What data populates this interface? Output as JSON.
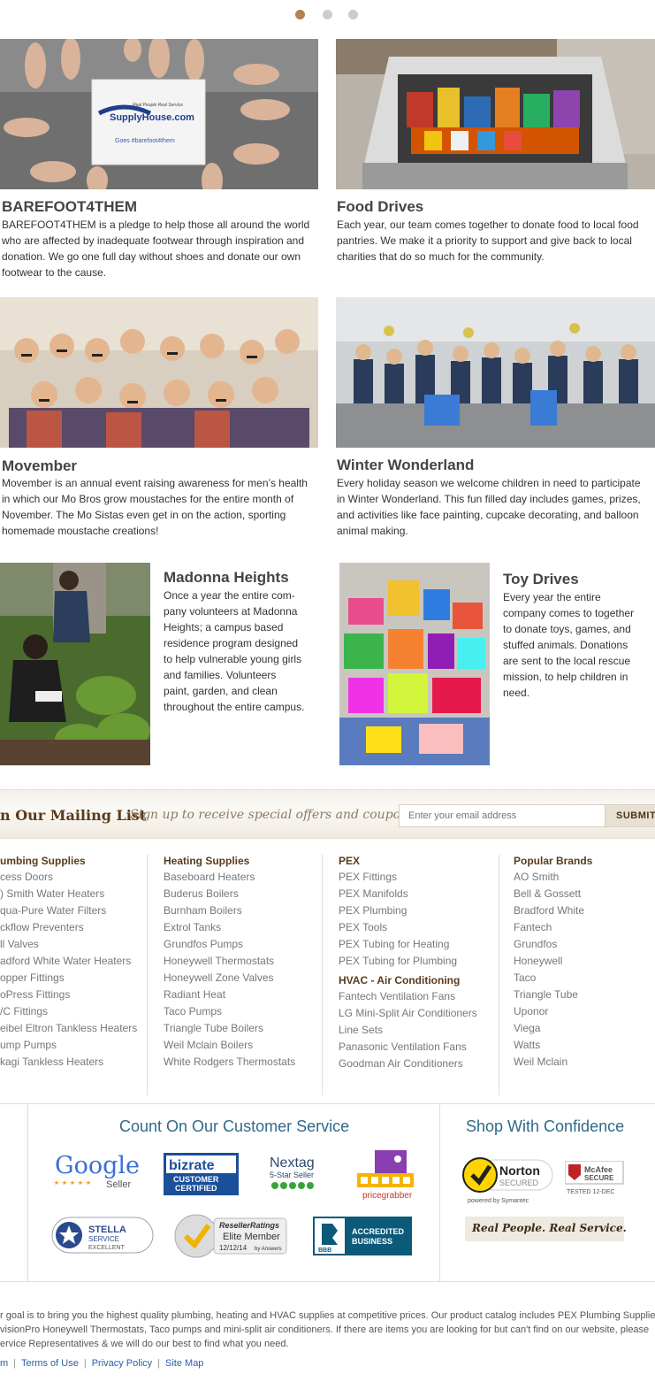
{
  "carousel": {
    "dots": 3,
    "active_index": 0
  },
  "cards": [
    {
      "title": "BAREFOOT4THEM",
      "text": [
        "BAREFOOT4THEM is a pledge to help those all around the world",
        "who are affected by inadequate footwear through inspiration and",
        "donation. We go one full day without shoes and donate our own",
        "footwear to the cause."
      ],
      "photo_text": [
        "Real People Real Service",
        "SupplyHouse.com",
        "Goes #barefoot4them"
      ]
    },
    {
      "title": "Food Drives",
      "text": [
        "Each year, our team comes together to donate food to local food",
        "pantries.  We make it a priority to support and give back to local",
        "charities that do so much for the community."
      ]
    },
    {
      "title": "Movember",
      "text": [
        "Movember is an annual event raising awareness for men’s health",
        "in which our Mo Bros grow moustaches for the entire month of",
        "November. The Mo Sistas even get in on the action, sporting",
        "homemade moustache creations!"
      ]
    },
    {
      "title": "Winter Wonderland",
      "text": [
        "Every holiday season we welcome children in need to participate",
        "in Winter Wonderland. This fun filled day includes games, prizes,",
        "and activities like face painting, cupcake decorating, and balloon",
        "animal making."
      ]
    },
    {
      "title": "Madonna Heights",
      "text": [
        "Once a year the entire com-",
        "pany volunteers at Madonna",
        "Heights; a campus based",
        "residence program designed",
        "to help vulnerable young girls",
        "and families.  Volunteers",
        "paint, garden, and clean",
        "throughout the entire campus."
      ]
    },
    {
      "title": "Toy Drives",
      "text": [
        "Every year the entire",
        "company comes to together",
        "to donate toys, games, and",
        "stuffed animals. Donations",
        "are sent to the local rescue",
        "mission, to help children in",
        "need."
      ]
    }
  ],
  "mailing": {
    "title": "n Our Mailing List",
    "subtitle": "Sign up to receive special offers and coupons",
    "placeholder": "Enter your email address",
    "button": "SUBMIT"
  },
  "columns": [
    {
      "groups": [
        {
          "head": "umbing Supplies",
          "links": [
            "cess Doors",
            ") Smith Water Heaters",
            "qua-Pure Water Filters",
            "ckflow Preventers",
            "ll Valves",
            "adford White Water Heaters",
            "opper Fittings",
            "oPress Fittings",
            "/C Fittings",
            "eibel Eltron Tankless Heaters",
            "ump Pumps",
            "kagi Tankless Heaters"
          ]
        }
      ]
    },
    {
      "groups": [
        {
          "head": "Heating Supplies",
          "links": [
            "Baseboard Heaters",
            "Buderus Boilers",
            "Burnham Boilers",
            "Extrol Tanks",
            "Grundfos Pumps",
            "Honeywell Thermostats",
            "Honeywell Zone Valves",
            "Radiant Heat",
            "Taco Pumps",
            "Triangle Tube Boilers",
            "Weil Mclain Boilers",
            "White Rodgers Thermostats"
          ]
        }
      ]
    },
    {
      "groups": [
        {
          "head": "PEX",
          "links": [
            "PEX Fittings",
            "PEX Manifolds",
            "PEX Plumbing",
            "PEX Tools",
            "PEX Tubing for Heating",
            "PEX Tubing for Plumbing"
          ]
        },
        {
          "head": "HVAC - Air Conditioning",
          "links": [
            "Fantech Ventilation Fans",
            "LG Mini-Split Air Conditioners",
            "Line Sets",
            "Panasonic Ventilation Fans",
            "Goodman Air Conditioners"
          ]
        }
      ]
    },
    {
      "groups": [
        {
          "head": "Popular Brands",
          "links": [
            "AO Smith",
            "Bell & Gossett",
            "Bradford White",
            "Fantech",
            "Grundfos",
            "Honeywell",
            "Taco",
            "Triangle Tube",
            "Uponor",
            "Viega",
            "Watts",
            "Weil Mclain"
          ]
        }
      ]
    }
  ],
  "trust": {
    "service_head": "Count On Our Customer Service",
    "confidence_head": "Shop With Confidence",
    "badges": {
      "google": {
        "name": "Google",
        "sub": "Seller"
      },
      "bizrate": {
        "name": "bizrate",
        "l1": "CUSTOMER",
        "l2": "CERTIFIED"
      },
      "nextag": {
        "name": "Nextag",
        "sub": "5-Star Seller"
      },
      "pricegrabber": {
        "name": "pricegrabber"
      },
      "stella": {
        "l1": "STELLA",
        "l2": "SERVICE",
        "l3": "EXCELLENT"
      },
      "resellerratings": {
        "l1": "ResellerRatings",
        "l2": "Elite Member",
        "l3": "12/12/14",
        "l4": "by Answers"
      },
      "bbb": {
        "l1": "ACCREDITED",
        "l2": "BUSINESS",
        "logo": "BBB"
      },
      "norton": {
        "l1": "Norton",
        "l2": "SECURED",
        "l3": "powered by Symantec"
      },
      "mcafee": {
        "l1": "McAfee",
        "l2": "SECURE",
        "l3": "TESTED 12-DEC"
      },
      "realpeople": {
        "text": "Real People. Real Service."
      }
    }
  },
  "footer": {
    "lines": [
      "r goal is to bring you the highest quality plumbing, heating and HVAC supplies at competitive prices. Our product catalog includes PEX Plumbing Supplie",
      "visionPro Honeywell Thermostats, Taco pumps and mini-split air conditioners. If there are items you are looking for but can't find on our website, please",
      "ervice Representatives & we will do our best to find what you need."
    ],
    "links": [
      "m",
      "Terms of Use",
      "Privacy Policy",
      "Site Map"
    ]
  },
  "colors": {
    "accent": "#b4824f",
    "heading_brown": "#5a3b1d",
    "trust_blue": "#2f6a8a",
    "link_blue": "#2a5ea8"
  }
}
